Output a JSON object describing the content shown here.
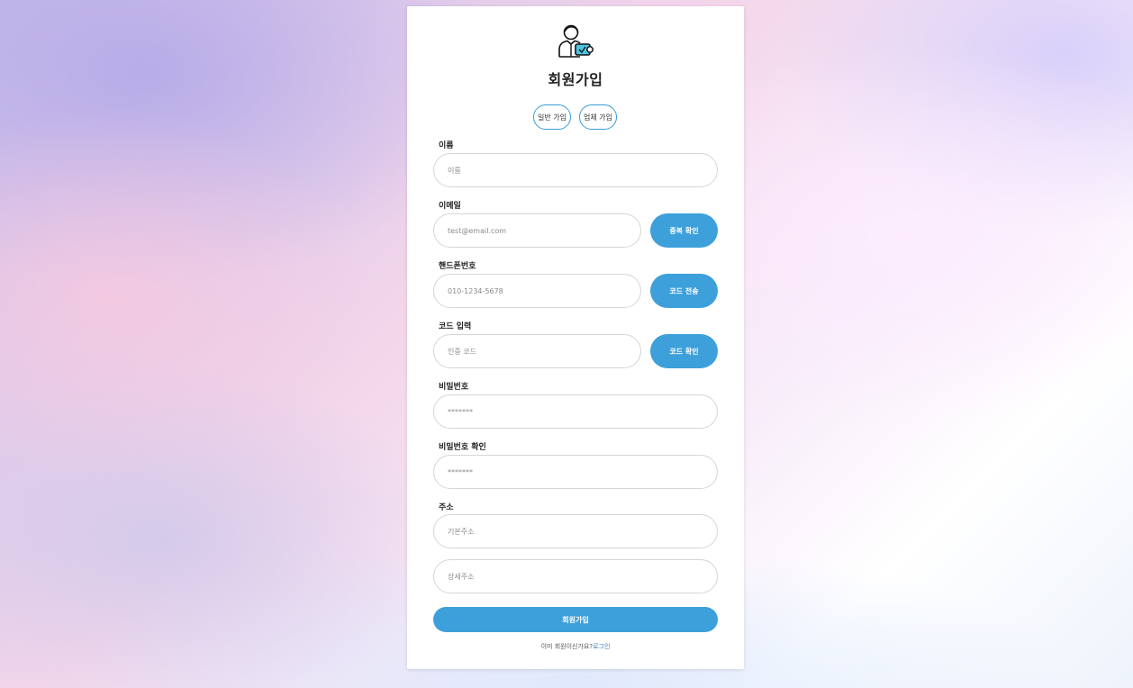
{
  "header": {
    "title": "회원가입",
    "logo_icon": "user-card-icon"
  },
  "signup_type": {
    "personal_label": "일반 가입",
    "business_label": "업체 가입"
  },
  "form": {
    "name": {
      "label": "이름",
      "placeholder": "이름",
      "value": ""
    },
    "email": {
      "label": "이메일",
      "placeholder": "test@email.com",
      "value": "",
      "button_label": "중복 확인"
    },
    "phone": {
      "label": "핸드폰번호",
      "placeholder": "010-1234-5678",
      "value": "",
      "button_label": "코드 전송"
    },
    "code": {
      "label": "코드 입력",
      "placeholder": "인증 코드",
      "value": "",
      "button_label": "코드 확인"
    },
    "password": {
      "label": "비밀번호",
      "placeholder": "*******",
      "value": ""
    },
    "password_confirm": {
      "label": "비밀번호 확인",
      "placeholder": "*******",
      "value": ""
    },
    "address": {
      "label": "주소",
      "basic_placeholder": "기본주소",
      "detail_placeholder": "상세주소",
      "basic_value": "",
      "detail_value": ""
    }
  },
  "submit_label": "회원가입",
  "footer": {
    "question": "이미 회원이신가요?",
    "login_link": "로그인"
  },
  "colors": {
    "accent": "#3da0da",
    "outline_accent": "#3a9ed8",
    "logo_accent": "#4fc3e0"
  }
}
